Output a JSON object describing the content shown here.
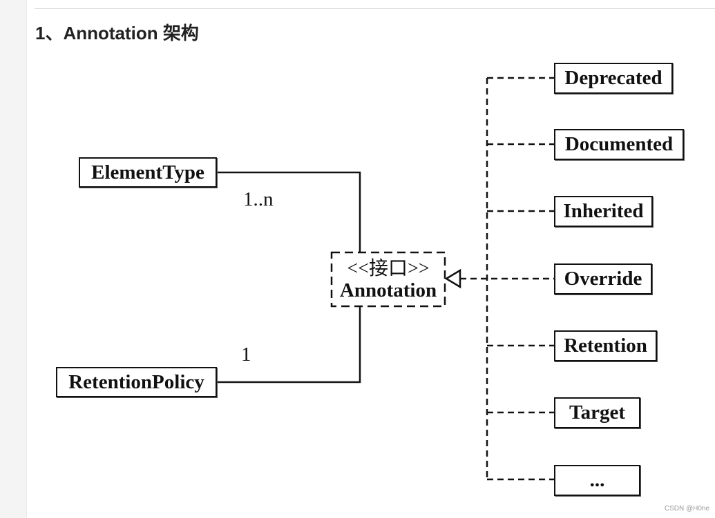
{
  "page": {
    "heading": "1、Annotation 架构",
    "watermark": "CSDN @H0ne"
  },
  "diagram": {
    "interface": {
      "stereotype": "<<接口>>",
      "name": "Annotation"
    },
    "associations": [
      {
        "name": "ElementType",
        "multiplicity": "1..n"
      },
      {
        "name": "RetentionPolicy",
        "multiplicity": "1"
      }
    ],
    "implementations": [
      "Deprecated",
      "Documented",
      "Inherited",
      "Override",
      "Retention",
      "Target",
      "..."
    ]
  }
}
